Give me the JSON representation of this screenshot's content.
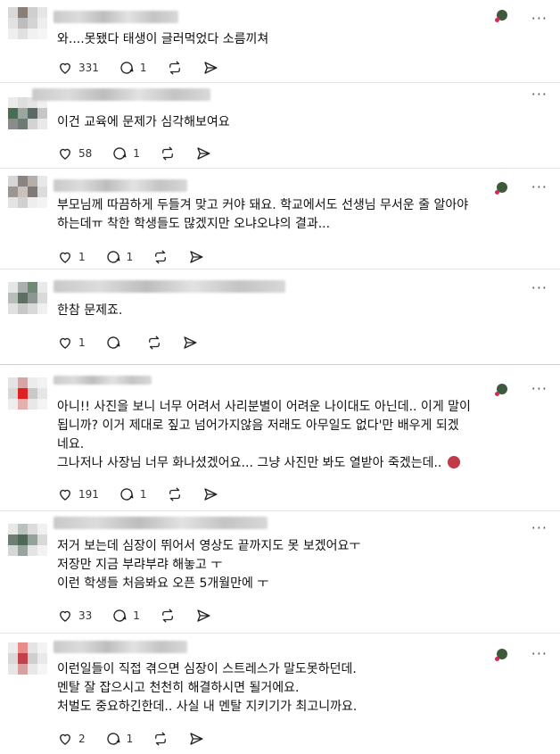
{
  "comments": [
    {
      "text_lines": [
        "와....못됐다 태생이 글러먹었다 소름끼쳐"
      ],
      "likes": "331",
      "replies": "1",
      "author_liked": true
    },
    {
      "text_lines": [
        "이건 교육에 문제가 심각해보여요"
      ],
      "likes": "58",
      "replies": "1",
      "author_liked": false
    },
    {
      "text_lines": [
        "부모님께 따끔하게 두들겨 맞고 커야 돼요. 학교에서도 선생님 무서운 줄 알아야",
        "하는데ㅠ 착한 학생들도 많겠지만 오냐오냐의 결과..."
      ],
      "likes": "1",
      "replies": "1",
      "author_liked": true
    },
    {
      "text_lines": [
        "한참 문제죠."
      ],
      "likes": "1",
      "replies": "",
      "author_liked": false
    },
    {
      "text_lines": [
        "아니!! 사진을 보니 너무 어려서 사리분별이 어려운 나이대도 아닌데.. 이게 말이",
        "됩니까? 이거 제대로 짚고 넘어가지않음 저래도 아무일도 없다'만 배우게 되겠",
        "네요.",
        "그나저나 사장님 너무 화나셨겠어요... 그냥 사진만 봐도 열받아 죽겠는데.."
      ],
      "likes": "191",
      "replies": "1",
      "author_liked": true
    },
    {
      "text_lines": [
        "저거 보는데 심장이 뛰어서 영상도 끝까지도 못 보겠어요ㅜ",
        "저장만 지금 부랴부랴 해놓고 ㅜ",
        "이런 학생들 처음봐요 오픈 5개월만에 ㅜ"
      ],
      "likes": "33",
      "replies": "1",
      "author_liked": false
    },
    {
      "text_lines": [
        "이런일들이 직접 겪으면 심장이 스트레스가 말도못하던데.",
        "멘탈 잘 잡으시고 천천히 해결하시면 될거에요.",
        "처벌도 중요하긴한데.. 사실 내 멘탈 지키기가 최고니까요."
      ],
      "likes": "2",
      "replies": "1",
      "author_liked": true
    }
  ],
  "more_label": "···",
  "colors": {
    "text": "#111111",
    "muted": "#555555",
    "heart_badge": "#e0245e",
    "author_badge": "#3d5a3a"
  },
  "icons": [
    "heart-icon",
    "comment-icon",
    "repost-icon",
    "share-icon",
    "more-icon"
  ]
}
